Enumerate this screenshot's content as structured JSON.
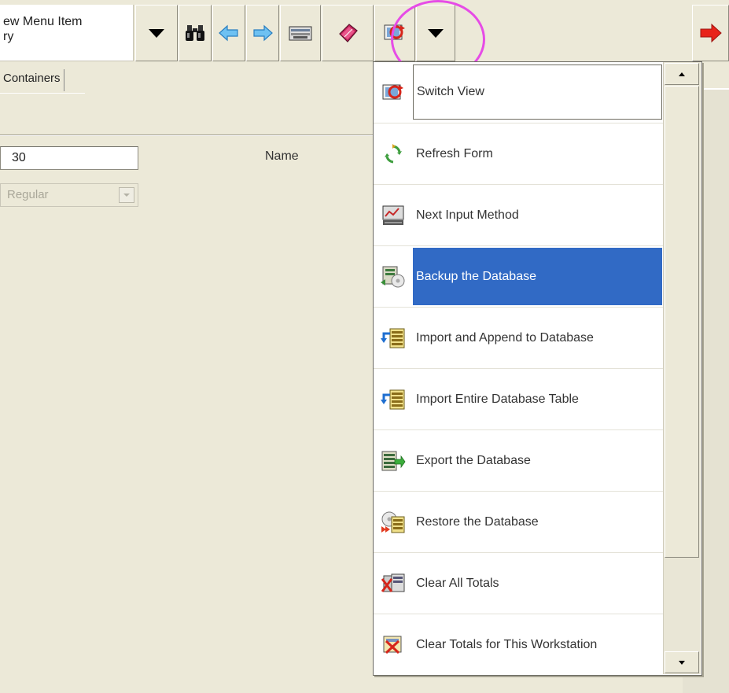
{
  "toolbar": {
    "record_line1": "ew Menu Item",
    "record_line2": "ry",
    "buttons": [
      {
        "icon": "chevron-down-icon"
      },
      {
        "icon": "binoculars-icon"
      },
      {
        "icon": "arrow-left-icon"
      },
      {
        "icon": "arrow-right-icon"
      },
      {
        "icon": "keyboard-icon"
      },
      {
        "icon": "book-icon"
      },
      {
        "icon": "switch-view-icon"
      },
      {
        "icon": "chevron-down-icon"
      },
      {
        "icon": "exit-arrow-icon"
      }
    ],
    "accent_colors": {
      "highlight_circle": "#e64ce6",
      "exit_arrow": "#e8231a"
    }
  },
  "form": {
    "tab_label": "Containers",
    "number_value": "30",
    "name_label": "Name",
    "style_select_value": "Regular"
  },
  "menu": {
    "selected_color": "#316ac5",
    "items": [
      {
        "label": "Switch View",
        "icon": "switch-view-icon"
      },
      {
        "label": "Refresh Form",
        "icon": "refresh-icon"
      },
      {
        "label": "Next Input Method",
        "icon": "input-method-icon"
      },
      {
        "label": "Backup the Database",
        "icon": "backup-database-icon",
        "selected": true
      },
      {
        "label": "Import and Append to Database",
        "icon": "import-append-icon"
      },
      {
        "label": "Import Entire Database Table",
        "icon": "import-table-icon"
      },
      {
        "label": "Export the Database",
        "icon": "export-database-icon"
      },
      {
        "label": "Restore the Database",
        "icon": "restore-database-icon"
      },
      {
        "label": "Clear All Totals",
        "icon": "clear-all-totals-icon"
      },
      {
        "label": "Clear Totals for This Workstation",
        "icon": "clear-workstation-totals-icon"
      }
    ]
  }
}
